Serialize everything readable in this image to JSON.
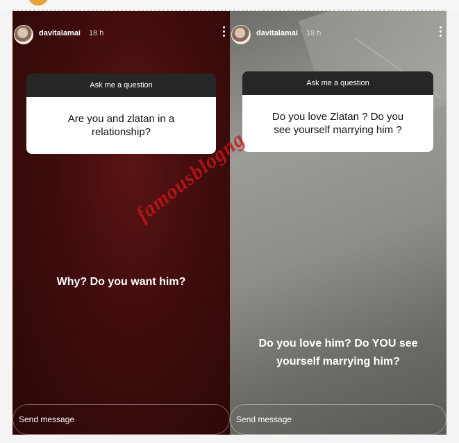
{
  "stories": [
    {
      "username": "davitalamai",
      "time": "18 h",
      "question_sticker_title": "Ask me a question",
      "question": "Are you and zlatan in a relationship?",
      "answer": "Why? Do you want him?",
      "send_placeholder": "Send message"
    },
    {
      "username": "davitalamai",
      "time": "18 h",
      "question_sticker_title": "Ask me a question",
      "question": "Do you love Zlatan ? Do you see yourself marrying him ?",
      "answer": "Do you love him? Do YOU see yourself marrying him?",
      "send_placeholder": "Send message"
    }
  ],
  "watermark": "famousblogng",
  "colors": {
    "left_background": "#3f0c0c",
    "right_background": "#8e8e88",
    "watermark": "#c8141e",
    "sticker_header": "#262626"
  },
  "icons": [
    "avatar",
    "more-options-icon"
  ]
}
